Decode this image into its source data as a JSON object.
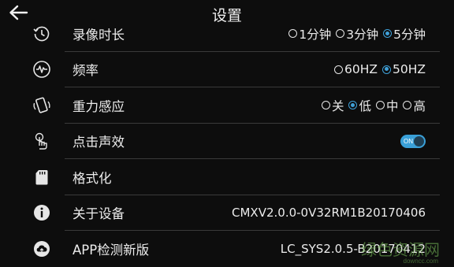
{
  "header": {
    "title": "设置",
    "back_icon": "arrow-left-icon"
  },
  "settings": {
    "record_duration": {
      "label": "录像时长",
      "icon": "clock-rotate-icon",
      "options": [
        "1分钟",
        "3分钟",
        "5分钟"
      ],
      "selected": "5分钟"
    },
    "frequency": {
      "label": "频率",
      "icon": "waveform-icon",
      "options": [
        "60HZ",
        "50HZ"
      ],
      "selected": "50HZ"
    },
    "gravity_sensor": {
      "label": "重力感应",
      "icon": "phone-rotate-icon",
      "options": [
        "关",
        "低",
        "中",
        "高"
      ],
      "selected": "低"
    },
    "click_sound": {
      "label": "点击声效",
      "icon": "tap-finger-icon",
      "toggle_label": "ON",
      "toggle_on": true
    },
    "format": {
      "label": "格式化",
      "icon": "sd-card-icon"
    },
    "about_device": {
      "label": "关于设备",
      "icon": "info-icon",
      "value": "CMXV2.0.0-0V32RM1B20170406"
    },
    "app_update": {
      "label": "APP检测新版",
      "icon": "cloud-upload-icon",
      "value": "LC_SYS2.0.5-B20170412"
    }
  },
  "watermark": {
    "text": "绿色资源网",
    "sub": "downcc.com"
  },
  "colors": {
    "background": "#0d0d0d",
    "accent": "#3fa0d8",
    "separator": "#3a3a3a",
    "text": "#ececec"
  }
}
